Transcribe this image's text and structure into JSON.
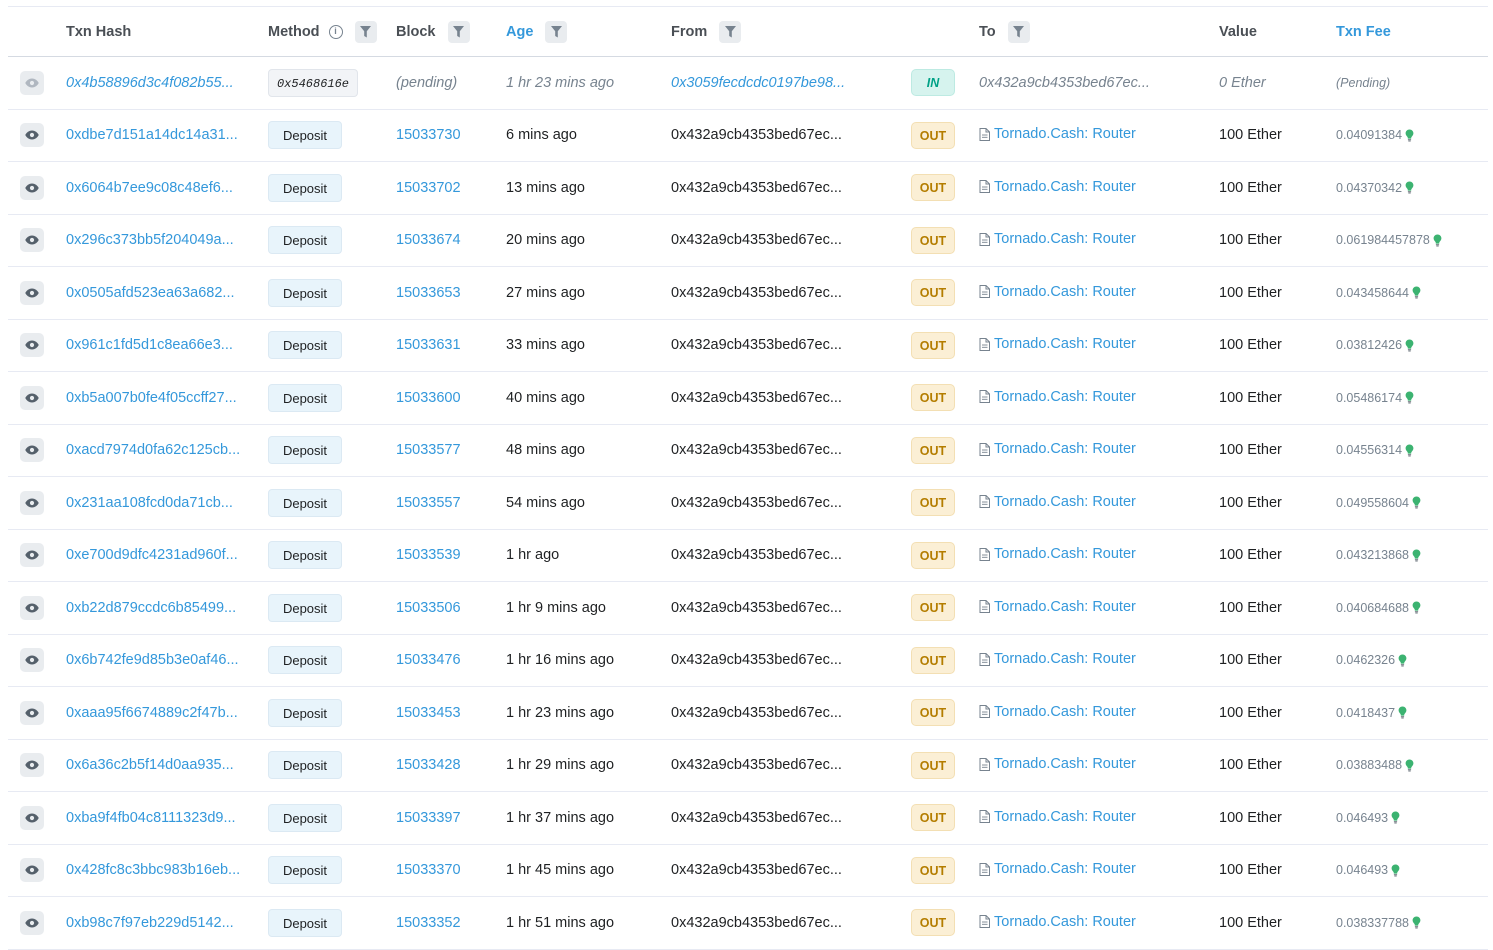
{
  "columns": {
    "txn_hash": "Txn Hash",
    "method": "Method",
    "block": "Block",
    "age": "Age",
    "from": "From",
    "to": "To",
    "value": "Value",
    "txn_fee": "Txn Fee"
  },
  "colors": {
    "link": "#3498db",
    "out_bg": "#fbefd5",
    "out_text": "#b47d00",
    "in_bg": "#d6f3ee",
    "in_text": "#00a186",
    "bulb": "#3cb371"
  },
  "icons": {
    "view": "eye-icon",
    "filter": "filter-icon",
    "info": "info-icon",
    "contract": "contract-file-icon",
    "fee": "lightbulb-icon"
  },
  "rows": [
    {
      "hash": "0x4b58896d3c4f082b55...",
      "method": "0x5468616e",
      "block": "(pending)",
      "age": "1 hr 23 mins ago",
      "from": "0x3059fecdcdc0197be98...",
      "dir": "IN",
      "to": "0x432a9cb4353bed67ec...",
      "value": "0 Ether",
      "fee": "(Pending)",
      "pending": true
    },
    {
      "hash": "0xdbe7d151a14dc14a31...",
      "method": "Deposit",
      "block": "15033730",
      "age": "6 mins ago",
      "from": "0x432a9cb4353bed67ec...",
      "dir": "OUT",
      "to": "Tornado.Cash: Router",
      "value": "100 Ether",
      "fee": "0.04091384",
      "pending": false
    },
    {
      "hash": "0x6064b7ee9c08c48ef6...",
      "method": "Deposit",
      "block": "15033702",
      "age": "13 mins ago",
      "from": "0x432a9cb4353bed67ec...",
      "dir": "OUT",
      "to": "Tornado.Cash: Router",
      "value": "100 Ether",
      "fee": "0.04370342",
      "pending": false
    },
    {
      "hash": "0x296c373bb5f204049a...",
      "method": "Deposit",
      "block": "15033674",
      "age": "20 mins ago",
      "from": "0x432a9cb4353bed67ec...",
      "dir": "OUT",
      "to": "Tornado.Cash: Router",
      "value": "100 Ether",
      "fee": "0.061984457878",
      "pending": false
    },
    {
      "hash": "0x0505afd523ea63a682...",
      "method": "Deposit",
      "block": "15033653",
      "age": "27 mins ago",
      "from": "0x432a9cb4353bed67ec...",
      "dir": "OUT",
      "to": "Tornado.Cash: Router",
      "value": "100 Ether",
      "fee": "0.043458644",
      "pending": false
    },
    {
      "hash": "0x961c1fd5d1c8ea66e3...",
      "method": "Deposit",
      "block": "15033631",
      "age": "33 mins ago",
      "from": "0x432a9cb4353bed67ec...",
      "dir": "OUT",
      "to": "Tornado.Cash: Router",
      "value": "100 Ether",
      "fee": "0.03812426",
      "pending": false
    },
    {
      "hash": "0xb5a007b0fe4f05ccff27...",
      "method": "Deposit",
      "block": "15033600",
      "age": "40 mins ago",
      "from": "0x432a9cb4353bed67ec...",
      "dir": "OUT",
      "to": "Tornado.Cash: Router",
      "value": "100 Ether",
      "fee": "0.05486174",
      "pending": false
    },
    {
      "hash": "0xacd7974d0fa62c125cb...",
      "method": "Deposit",
      "block": "15033577",
      "age": "48 mins ago",
      "from": "0x432a9cb4353bed67ec...",
      "dir": "OUT",
      "to": "Tornado.Cash: Router",
      "value": "100 Ether",
      "fee": "0.04556314",
      "pending": false
    },
    {
      "hash": "0x231aa108fcd0da71cb...",
      "method": "Deposit",
      "block": "15033557",
      "age": "54 mins ago",
      "from": "0x432a9cb4353bed67ec...",
      "dir": "OUT",
      "to": "Tornado.Cash: Router",
      "value": "100 Ether",
      "fee": "0.049558604",
      "pending": false
    },
    {
      "hash": "0xe700d9dfc4231ad960f...",
      "method": "Deposit",
      "block": "15033539",
      "age": "1 hr ago",
      "from": "0x432a9cb4353bed67ec...",
      "dir": "OUT",
      "to": "Tornado.Cash: Router",
      "value": "100 Ether",
      "fee": "0.043213868",
      "pending": false
    },
    {
      "hash": "0xb22d879ccdc6b85499...",
      "method": "Deposit",
      "block": "15033506",
      "age": "1 hr 9 mins ago",
      "from": "0x432a9cb4353bed67ec...",
      "dir": "OUT",
      "to": "Tornado.Cash: Router",
      "value": "100 Ether",
      "fee": "0.040684688",
      "pending": false
    },
    {
      "hash": "0x6b742fe9d85b3e0af46...",
      "method": "Deposit",
      "block": "15033476",
      "age": "1 hr 16 mins ago",
      "from": "0x432a9cb4353bed67ec...",
      "dir": "OUT",
      "to": "Tornado.Cash: Router",
      "value": "100 Ether",
      "fee": "0.0462326",
      "pending": false
    },
    {
      "hash": "0xaaa95f6674889c2f47b...",
      "method": "Deposit",
      "block": "15033453",
      "age": "1 hr 23 mins ago",
      "from": "0x432a9cb4353bed67ec...",
      "dir": "OUT",
      "to": "Tornado.Cash: Router",
      "value": "100 Ether",
      "fee": "0.0418437",
      "pending": false
    },
    {
      "hash": "0x6a36c2b5f14d0aa935...",
      "method": "Deposit",
      "block": "15033428",
      "age": "1 hr 29 mins ago",
      "from": "0x432a9cb4353bed67ec...",
      "dir": "OUT",
      "to": "Tornado.Cash: Router",
      "value": "100 Ether",
      "fee": "0.03883488",
      "pending": false
    },
    {
      "hash": "0xba9f4fb04c8111323d9...",
      "method": "Deposit",
      "block": "15033397",
      "age": "1 hr 37 mins ago",
      "from": "0x432a9cb4353bed67ec...",
      "dir": "OUT",
      "to": "Tornado.Cash: Router",
      "value": "100 Ether",
      "fee": "0.046493",
      "pending": false
    },
    {
      "hash": "0x428fc8c3bbc983b16eb...",
      "method": "Deposit",
      "block": "15033370",
      "age": "1 hr 45 mins ago",
      "from": "0x432a9cb4353bed67ec...",
      "dir": "OUT",
      "to": "Tornado.Cash: Router",
      "value": "100 Ether",
      "fee": "0.046493",
      "pending": false
    },
    {
      "hash": "0xb98c7f97eb229d5142...",
      "method": "Deposit",
      "block": "15033352",
      "age": "1 hr 51 mins ago",
      "from": "0x432a9cb4353bed67ec...",
      "dir": "OUT",
      "to": "Tornado.Cash: Router",
      "value": "100 Ether",
      "fee": "0.038337788",
      "pending": false
    }
  ]
}
